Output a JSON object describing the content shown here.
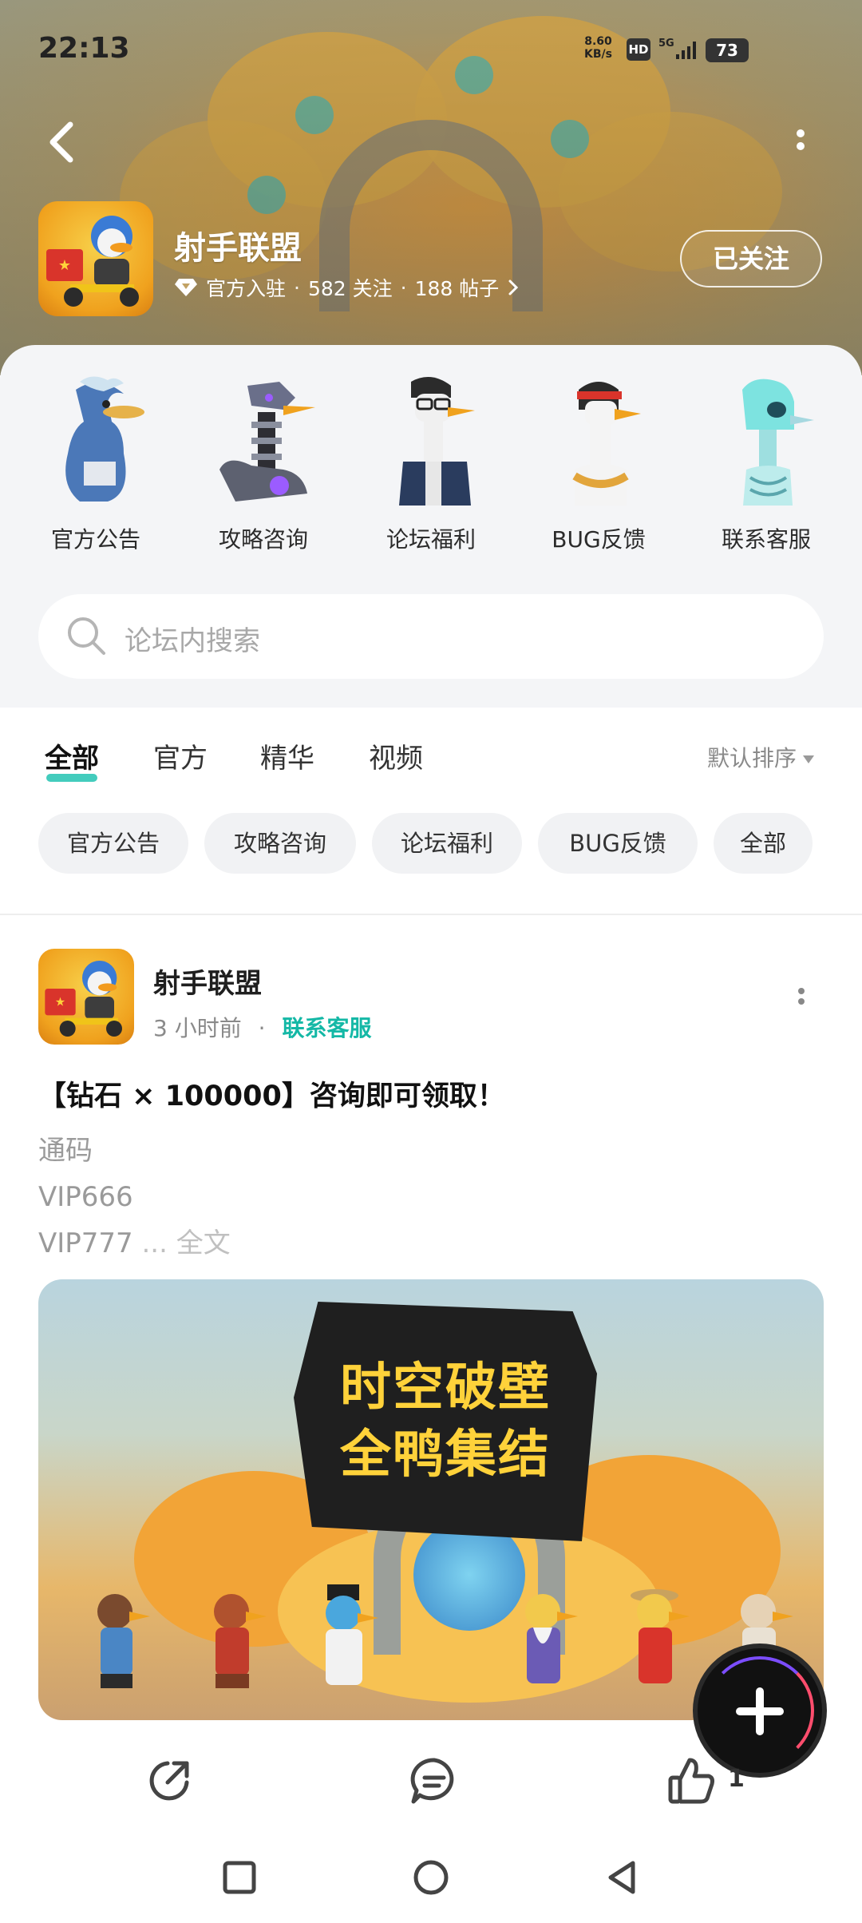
{
  "status_bar": {
    "time": "22:13",
    "net_speed_value": "8.60",
    "net_speed_unit": "KB/s",
    "hd": "HD",
    "network": "5G",
    "battery": "73"
  },
  "forum": {
    "name": "射手联盟",
    "badge": "官方入驻",
    "followers": "582 关注",
    "posts": "188 帖子",
    "follow_label": "已关注"
  },
  "shortcuts": [
    {
      "label": "官方公告",
      "icon": "pelican-character"
    },
    {
      "label": "攻略咨询",
      "icon": "robot-goose-character"
    },
    {
      "label": "论坛福利",
      "icon": "goose-with-glasses-character"
    },
    {
      "label": "BUG反馈",
      "icon": "goose-with-headband-character"
    },
    {
      "label": "联系客服",
      "icon": "ghost-goose-character"
    }
  ],
  "search": {
    "placeholder": "论坛内搜索"
  },
  "tabs": [
    {
      "label": "全部",
      "active": true
    },
    {
      "label": "官方",
      "active": false
    },
    {
      "label": "精华",
      "active": false
    },
    {
      "label": "视频",
      "active": false
    }
  ],
  "sort_label": "默认排序",
  "chips": [
    "官方公告",
    "攻略咨询",
    "论坛福利",
    "BUG反馈",
    "全部"
  ],
  "post": {
    "author": "射手联盟",
    "time": "3 小时前",
    "separator": "·",
    "category": "联系客服",
    "title": "【钻石 × 100000】咨询即可领取！",
    "lines": [
      "通码",
      "VIP666",
      "VIP777"
    ],
    "more_text": " ... 全文",
    "image_text": [
      "时空破壁",
      "全鸭集结"
    ],
    "like_count": "1"
  },
  "colors": {
    "accent": "#14b8a6",
    "panel_bg": "#f4f5f7",
    "chip_bg": "#f1f2f4",
    "banner_title": "#ffffff"
  }
}
